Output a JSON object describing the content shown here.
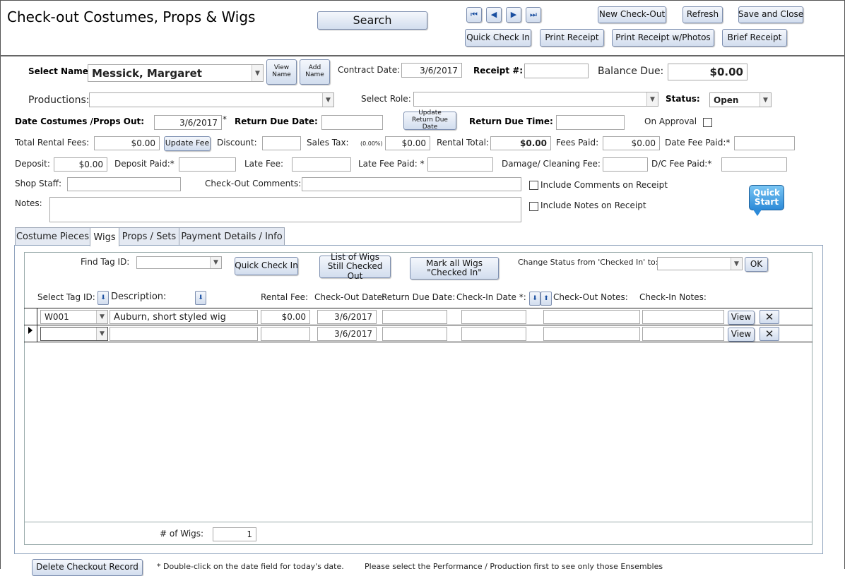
{
  "header": {
    "title": "Check-out Costumes, Props & Wigs",
    "search_label": "Search",
    "nav": {
      "first": "⏮",
      "prev": "◀",
      "next": "▶",
      "last": "⏭"
    },
    "new_checkout": "New Check-Out",
    "refresh": "Refresh",
    "save_close": "Save and Close",
    "quick_check_in": "Quick Check In",
    "print_receipt": "Print Receipt",
    "print_receipt_photos": "Print Receipt w/Photos",
    "brief_receipt": "Brief Receipt"
  },
  "form": {
    "select_name_label": "Select Name:",
    "select_name_value": "Messick, Margaret",
    "view_name": "View Name",
    "add_name": "Add Name",
    "contract_date_label": "Contract Date:",
    "contract_date_value": "3/6/2017",
    "receipt_label": "Receipt #:",
    "receipt_value": "",
    "balance_due_label": "Balance Due:",
    "balance_due_value": "$0.00",
    "productions_label": "Productions:",
    "productions_value": "",
    "select_role_label": "Select Role:",
    "select_role_value": "",
    "status_label": "Status:",
    "status_value": "Open",
    "date_out_label": "Date Costumes /Props Out:",
    "date_out_value": "3/6/2017",
    "date_out_asterisk": "*",
    "return_due_date_label": "Return Due Date:",
    "return_due_date_value": "",
    "update_return_due_date": "Update Return Due Date",
    "return_due_time_label": "Return Due Time:",
    "return_due_time_value": "",
    "on_approval_label": "On Approval",
    "total_rental_label": "Total Rental Fees:",
    "total_rental_value": "$0.00",
    "update_fee": "Update Fee",
    "discount_label": "Discount:",
    "discount_value": "",
    "sales_tax_label": "Sales Tax:",
    "sales_tax_pct": "(0.00%)",
    "sales_tax_value": "$0.00",
    "rental_total_label": "Rental Total:",
    "rental_total_value": "$0.00",
    "fees_paid_label": "Fees Paid:",
    "fees_paid_value": "$0.00",
    "date_fee_paid_label": "Date Fee Paid:*",
    "date_fee_paid_value": "",
    "deposit_label": "Deposit:",
    "deposit_value": "$0.00",
    "deposit_paid_label": "Deposit Paid:*",
    "deposit_paid_value": "",
    "late_fee_label": "Late Fee:",
    "late_fee_value": "",
    "late_fee_paid_label": "Late Fee Paid: *",
    "late_fee_paid_value": "",
    "damage_fee_label": "Damage/ Cleaning Fee:",
    "damage_fee_value": "",
    "dc_fee_paid_label": "D/C Fee Paid:*",
    "dc_fee_paid_value": "",
    "shop_staff_label": "Shop Staff:",
    "shop_staff_value": "",
    "checkout_comments_label": "Check-Out Comments:",
    "checkout_comments_value": "",
    "include_comments_label": "Include Comments on Receipt",
    "notes_label": "Notes:",
    "notes_value": "",
    "include_notes_label": "Include Notes on Receipt",
    "quick_start": "Quick Start"
  },
  "tabs": [
    {
      "label": "Costume Pieces"
    },
    {
      "label": "Wigs"
    },
    {
      "label": "Props / Sets"
    },
    {
      "label": "Payment Details /  Info"
    }
  ],
  "wigs": {
    "find_tag_label": "Find Tag ID:",
    "find_tag_value": "",
    "quick_check_in": "Quick Check In",
    "list_wigs_out": "List of Wigs Still Checked Out",
    "mark_all_wigs": "Mark all Wigs \"Checked In\"",
    "change_status_label": "Change Status from 'Checked In'  to:",
    "change_status_value": "",
    "ok": "OK",
    "columns": {
      "select_tag": "Select Tag ID:",
      "description": "Description:",
      "rental_fee": "Rental Fee:",
      "checkout_date": "Check-Out Date:",
      "return_due": "Return Due Date:",
      "checkin_date": "Check-In Date *:",
      "checkout_notes": "Check-Out Notes:",
      "checkin_notes": "Check-In Notes:"
    },
    "rows": [
      {
        "tag": "W001",
        "description": "Auburn, short styled wig",
        "rental_fee": "$0.00",
        "checkout_date": "3/6/2017",
        "view": "View"
      },
      {
        "tag": "",
        "description": "",
        "rental_fee": "",
        "checkout_date": "3/6/2017",
        "view": "View"
      }
    ],
    "count_label": "# of Wigs:",
    "count_value": "1"
  },
  "footer": {
    "delete_checkout": "Delete Checkout Record",
    "note_double_click": "*  Double-click on the date field for today's date.",
    "note_select_production": "Please select the Performance / Production first to see only those Ensembles"
  },
  "colors": {
    "button_gradient_top": "#f4f7fc",
    "button_gradient_bottom": "#d2ddee",
    "quick_start_blue": "#2c8ad8"
  }
}
